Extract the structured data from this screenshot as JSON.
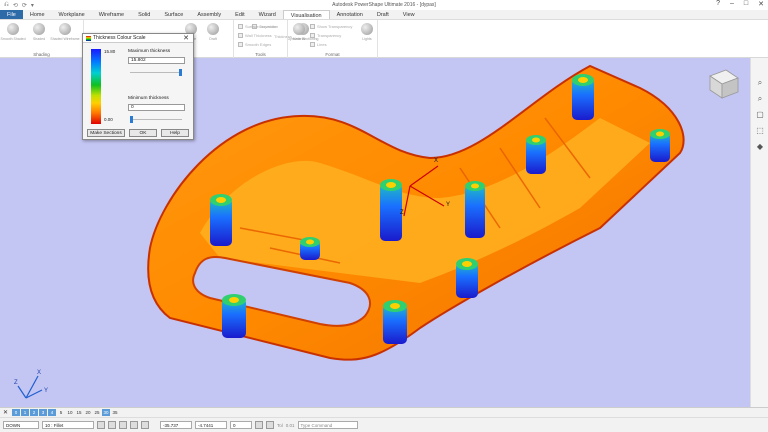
{
  "window": {
    "title": "Autodesk PowerShape Ultimate 2016 - [dypas]",
    "help_glyph": "?",
    "minimize_glyph": "–",
    "maximize_glyph": "□",
    "close_glyph": "✕"
  },
  "quick_access": [
    "⎌",
    "⟲",
    "⟳",
    "▾"
  ],
  "menu": {
    "tabs": [
      "File",
      "Home",
      "Workplane",
      "Wireframe",
      "Solid",
      "Surface",
      "Assembly",
      "Edit",
      "Wizard",
      "Visualisation",
      "Annotation",
      "Draft",
      "View"
    ],
    "active": "Visualisation"
  },
  "ribbon": {
    "shading_buttons": [
      "Smooth Shaded",
      "Shaded",
      "Shaded Wireframe",
      "Shade",
      "Draft",
      "Thickness"
    ],
    "shading_group": "Shading",
    "curvature_label": "Curvature",
    "thickness_label": "Thickness",
    "dynamic_label": "Dynamic Sectioning",
    "tools_items": [
      "Surface Inspection",
      "Wall Thickness",
      "Smooth Edges"
    ],
    "tools_group": "Tools",
    "format_items": [
      "Show Transparency",
      "Transparency",
      "Lines"
    ],
    "material_label": "Material",
    "lights_label": "Lights",
    "format_group": "Format"
  },
  "dialog": {
    "title": "Thickness Colour Scale",
    "close": "✕",
    "scale_max": "15.80",
    "scale_min": "0.00",
    "max_label": "Maximum thickness",
    "max_value": "15.802",
    "min_label": "Minimum thickness",
    "min_value": "0",
    "max_slider_fraction": 0.98,
    "min_slider_fraction": 0.02,
    "buttons": {
      "make_sections": "Make Sections",
      "ok": "OK",
      "help": "Help"
    }
  },
  "viewport": {
    "background": "#c3c5f3",
    "axis_x": "X",
    "axis_y": "Y",
    "axis_z": "Z",
    "triad_x": "X",
    "triad_y": "Y",
    "triad_z": "Z"
  },
  "side_tools": [
    "⌕",
    "⌕",
    "▢",
    "⬚",
    "◆"
  ],
  "levels": {
    "close": "✕",
    "items": [
      "0",
      "1",
      "2",
      "3",
      "4",
      "5",
      "10",
      "15",
      "20",
      "25",
      "30",
      "35"
    ],
    "highlighted": [
      "0",
      "1",
      "2",
      "3",
      "4",
      "30"
    ]
  },
  "bottom": {
    "mode": "DOWN",
    "fillet": "10 : Fillet",
    "x_coord": "-35.737",
    "y_coord": "-4.7441",
    "z_coord": "0",
    "tol_label": "Tol",
    "tol_value": "0.01",
    "command_placeholder": "Type Command"
  }
}
